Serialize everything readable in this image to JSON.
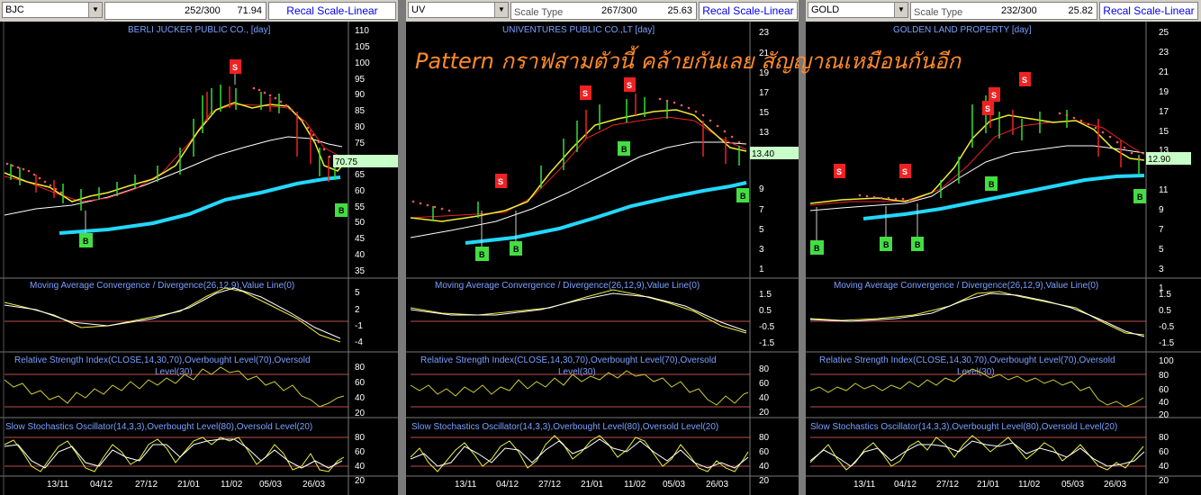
{
  "overlay_text": "Pattern กราฟสามตัวนี้ คล้ายกันเลย สัญญาณเหมือนกันอีก",
  "recal_label": "Recal Scale-Linear",
  "scale_type_label": "Scale Type",
  "macd_title": "Moving Average Convergence / Divergence(26,12,9),Value Line(0)",
  "rsi_title": "Relative Strength Index(CLOSE,14,30,70),Overbought Level(70),Oversold Level(30)",
  "rsi_title_line1": "Relative Strength Index(CLOSE,14,30,70),Overbought Level(70),Oversold",
  "rsi_title_line2": "Level(30)",
  "stoch_title": "Slow Stochastics Oscillator(14,3,3),Overbought Level(80),Oversold Level(20)",
  "date_labels": [
    "13/11",
    "04/12",
    "27/12",
    "21/01",
    "11/02",
    "05/03",
    "26/03"
  ],
  "colors": {
    "price_tag": "#c8ffc8",
    "buy": "#44dd44",
    "sell": "#ee2222",
    "ma_long": "#22d8ff",
    "macd": "#eeee44",
    "grid_red": "#ff6666"
  },
  "panels": [
    {
      "symbol": "BJC",
      "show_scale_type": false,
      "counter": "252/300",
      "value": "71.94",
      "title": "BERLI JUCKER PUBLIC CO., [day]",
      "price_tag": "70.75",
      "price_ticks": [
        "110",
        "105",
        "100",
        "95",
        "90",
        "85",
        "80",
        "75",
        "70",
        "65",
        "60",
        "55",
        "50",
        "45",
        "40",
        "35"
      ],
      "macd_ticks": [
        "5",
        "2",
        "-1",
        "-4"
      ],
      "rsi_ticks": [
        "80",
        "60",
        "40",
        "20"
      ],
      "stoch_ticks": [
        "80",
        "60",
        "40",
        "20"
      ],
      "signals": [
        "S",
        "B",
        "B"
      ]
    },
    {
      "symbol": "UV",
      "show_scale_type": true,
      "counter": "267/300",
      "value": "25.63",
      "title": "UNIVENTURES PUBLIC CO.,LT [day]",
      "price_tag": "13.40",
      "price_ticks": [
        "23",
        "21",
        "19",
        "17",
        "15",
        "13",
        "11",
        "9",
        "7",
        "5",
        "3",
        "1"
      ],
      "macd_ticks": [
        "1.5",
        "0.5",
        "-0.5",
        "-1.5"
      ],
      "rsi_ticks": [
        "80",
        "60",
        "40",
        "20"
      ],
      "stoch_ticks": [
        "80",
        "60",
        "40",
        "20"
      ],
      "signals": [
        "S",
        "S",
        "S",
        "B",
        "B",
        "B",
        "B"
      ]
    },
    {
      "symbol": "GOLD",
      "show_scale_type": true,
      "counter": "232/300",
      "value": "25.82",
      "title": "GOLDEN LAND PROPERTY [day]",
      "price_tag": "12.90",
      "price_ticks": [
        "25",
        "23",
        "21",
        "19",
        "17",
        "15",
        "13",
        "11",
        "9",
        "7",
        "5",
        "3",
        "1"
      ],
      "macd_ticks": [
        "1.5",
        "0.5",
        "-0.5",
        "-1.5"
      ],
      "rsi_ticks": [
        "100",
        "80",
        "60",
        "40",
        "20"
      ],
      "stoch_ticks": [
        "80",
        "60",
        "40",
        "20"
      ],
      "signals": [
        "S",
        "S",
        "S",
        "S",
        "S",
        "B",
        "B",
        "B",
        "B",
        "B"
      ]
    }
  ]
}
